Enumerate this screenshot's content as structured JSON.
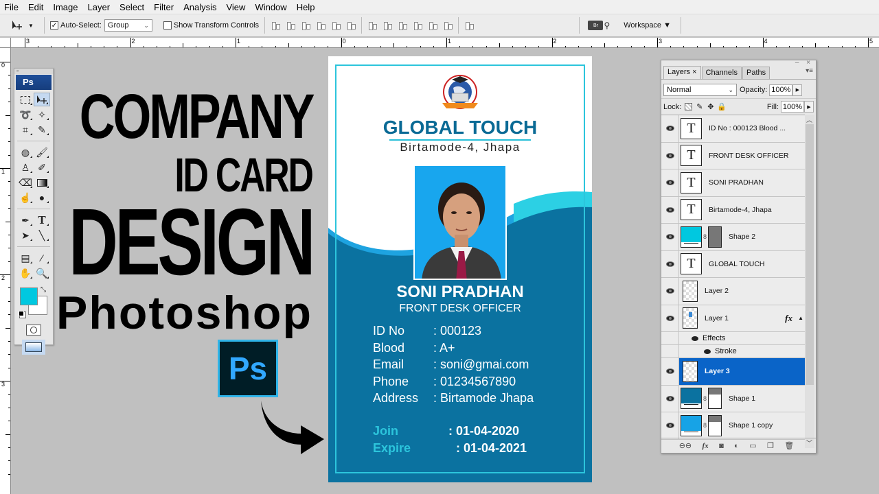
{
  "menu": [
    "File",
    "Edit",
    "Image",
    "Layer",
    "Select",
    "Filter",
    "Analysis",
    "View",
    "Window",
    "Help"
  ],
  "options_bar": {
    "auto_select_label": "Auto-Select:",
    "auto_select_checked": true,
    "auto_select_value": "Group",
    "show_transform_label": "Show Transform Controls",
    "show_transform_checked": false,
    "bridge_label": "Br",
    "workspace_label": "Workspace ▼"
  },
  "rulers": {
    "horizontal_labels": [
      "3",
      "2",
      "1",
      "0",
      "1",
      "2",
      "3",
      "4",
      "5"
    ],
    "vertical_labels": [
      "0",
      "1",
      "2",
      "3"
    ]
  },
  "tools_panel": {
    "header": "Ps",
    "foreground_color": "#00c8e0",
    "background_color": "#ffffff"
  },
  "headline": {
    "line1": "COMPANY",
    "line2": "ID CARD",
    "line3": "DESIGN",
    "line4": "Photoshop",
    "ps_logo_text": "Ps"
  },
  "card": {
    "colors": {
      "dark_blue": "#0b72a0",
      "cyan": "#2cc5dc",
      "brand": "#0a6a95"
    },
    "company": "GLOBAL TOUCH",
    "address": "Birtamode-4, Jhapa",
    "name": "SONI PRADHAN",
    "designation": "FRONT DESK OFFICER",
    "fields": [
      {
        "label": "ID No",
        "value": ": 000123"
      },
      {
        "label": "Blood",
        "value": ": A+"
      },
      {
        "label": "Email",
        "value": ": soni@gmai.com"
      },
      {
        "label": "Phone",
        "value": ": 01234567890"
      },
      {
        "label": "Address",
        "value": ": Birtamode Jhapa"
      }
    ],
    "dates": [
      {
        "label": "Join",
        "value": ": 01-04-2020"
      },
      {
        "label": "Expire",
        "value": ": 01-04-2021"
      }
    ]
  },
  "layers_panel": {
    "tabs": [
      "Layers ×",
      "Channels",
      "Paths"
    ],
    "blend_mode": "Normal",
    "opacity_label": "Opacity:",
    "opacity_value": "100%",
    "lock_label": "Lock:",
    "fill_label": "Fill:",
    "fill_value": "100%",
    "layers": [
      {
        "name": "ID No    : 000123 Blood    ...",
        "type": "text"
      },
      {
        "name": "FRONT DESK OFFICER",
        "type": "text"
      },
      {
        "name": "SONI PRADHAN",
        "type": "text"
      },
      {
        "name": "Birtamode-4, Jhapa",
        "type": "text"
      },
      {
        "name": "Shape 2",
        "type": "shape",
        "color": "#00c8e0"
      },
      {
        "name": "GLOBAL TOUCH",
        "type": "text"
      },
      {
        "name": "Layer 2",
        "type": "pixel"
      },
      {
        "name": "Layer 1",
        "type": "pixel",
        "fx": "fx",
        "effects_label": "Effects",
        "effect": "Stroke"
      },
      {
        "name": "Layer 3",
        "type": "pixel",
        "selected": true
      },
      {
        "name": "Shape 1",
        "type": "shape",
        "color": "#0b72a0"
      },
      {
        "name": "Shape 1 copy",
        "type": "shape",
        "color": "#17a3e6"
      }
    ]
  }
}
